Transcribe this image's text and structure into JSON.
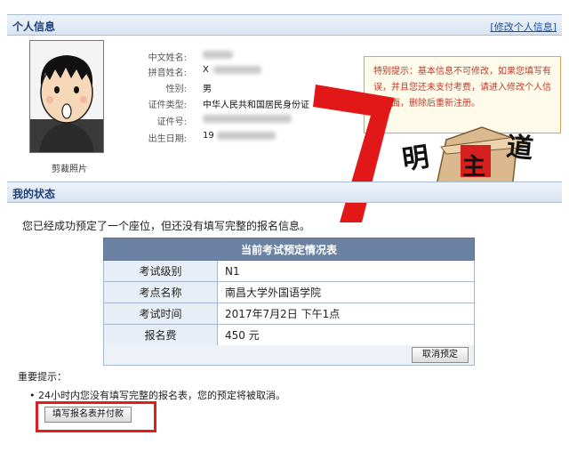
{
  "personal": {
    "section_title": "个人信息",
    "modify_link": "[修改个人信息]",
    "photo_caption": "剪裁照片",
    "fields": [
      {
        "label": "中文姓名:",
        "value": ""
      },
      {
        "label": "拼音姓名:",
        "value": "X"
      },
      {
        "label": "性别:",
        "value": "男"
      },
      {
        "label": "证件类型:",
        "value": "中华人民共和国居民身份证"
      },
      {
        "label": "证件号:",
        "value": ""
      },
      {
        "label": "出生日期:",
        "value": "19"
      }
    ],
    "notice": "特别提示：基本信息不可修改，如果您填写有误，并且您还未支付考费，请进入修改个人信息页面，删除后重新注册。"
  },
  "watermark": {
    "seven": "7",
    "logo_chars": [
      "明",
      "主",
      "道"
    ]
  },
  "status": {
    "section_title": "我的状态",
    "message": "您已经成功预定了一个座位，但还没有填写完整的报名信息。",
    "table": {
      "title": "当前考试预定情况表",
      "rows": [
        {
          "key": "考试级别",
          "value": "N1"
        },
        {
          "key": "考点名称",
          "value": "南昌大学外国语学院"
        },
        {
          "key": "考试时间",
          "value": "2017年7月2日 下午1点"
        },
        {
          "key": "报名费",
          "value": "450 元"
        }
      ],
      "cancel_button": "取消预定"
    },
    "important_title": "重要提示：",
    "important_item": "• 24小时内您没有填写完整的报名表，您的预定将被取消。",
    "fill_button": "填写报名表并付款"
  },
  "colors": {
    "header_text": "#1f3f7a",
    "notice_text": "#c0392b",
    "highlight": "#e21d1d",
    "table_header": "#6b82a3"
  }
}
